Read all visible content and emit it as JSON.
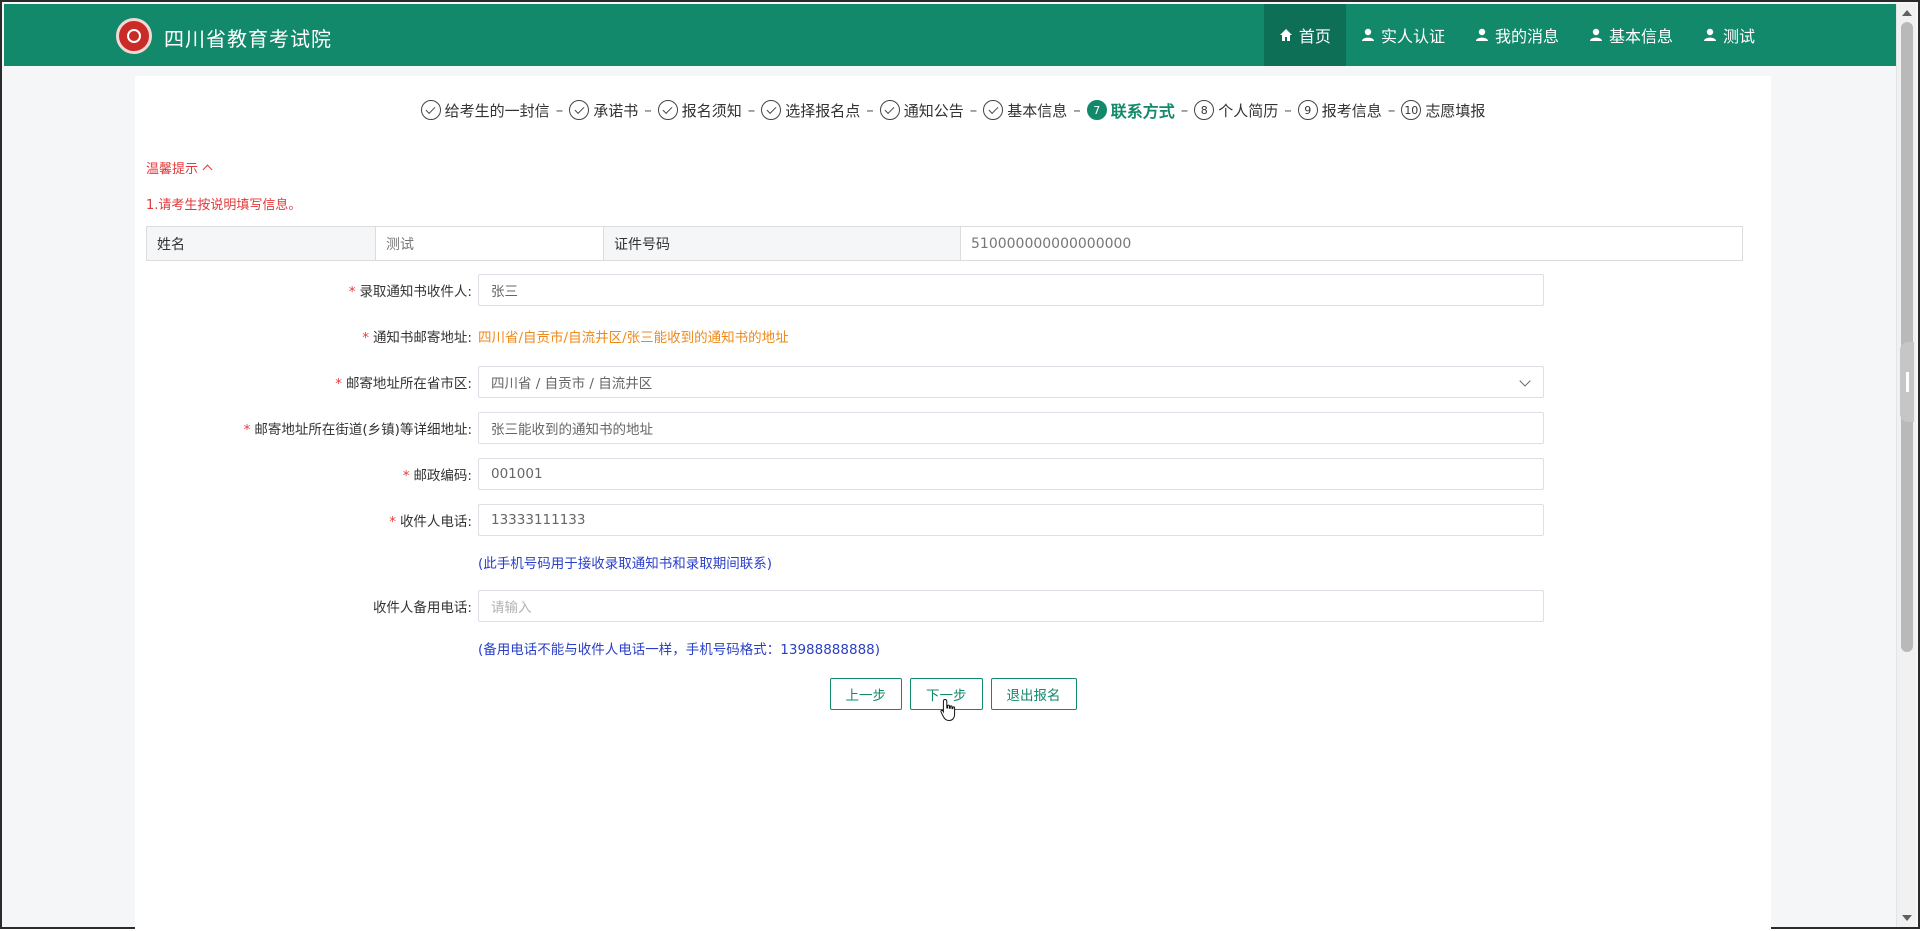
{
  "header": {
    "site_title": "四川省教育考试院",
    "nav": [
      {
        "label": "首页",
        "icon": "home-icon",
        "active": true
      },
      {
        "label": "实人认证",
        "icon": "user-icon"
      },
      {
        "label": "我的消息",
        "icon": "user-icon"
      },
      {
        "label": "基本信息",
        "icon": "user-icon"
      },
      {
        "label": "测试",
        "icon": "user-icon"
      }
    ]
  },
  "steps": [
    {
      "label": "给考生的一封信",
      "state": "done"
    },
    {
      "label": "承诺书",
      "state": "done"
    },
    {
      "label": "报名须知",
      "state": "done"
    },
    {
      "label": "选择报名点",
      "state": "done"
    },
    {
      "label": "通知公告",
      "state": "done"
    },
    {
      "label": "基本信息",
      "state": "done"
    },
    {
      "label": "联系方式",
      "state": "current",
      "number": "7"
    },
    {
      "label": "个人简历",
      "state": "todo",
      "number": "8"
    },
    {
      "label": "报考信息",
      "state": "todo",
      "number": "9"
    },
    {
      "label": "志愿填报",
      "state": "todo",
      "number": "10"
    }
  ],
  "tips": {
    "title": "温馨提示",
    "line1": "1.请考生按说明填写信息。"
  },
  "info": {
    "name_label": "姓名",
    "name_value": "测试",
    "id_label": "证件号码",
    "id_value": "510000000000000000"
  },
  "form": {
    "recipient_label": "录取通知书收件人:",
    "recipient_value": "张三",
    "address_label": "通知书邮寄地址:",
    "address_value": "四川省/自贡市/自流井区/张三能收到的通知书的地址",
    "region_label": "邮寄地址所在省市区:",
    "region_value": "四川省 / 自贡市 / 自流井区",
    "detail_label": "邮寄地址所在街道(乡镇)等详细地址:",
    "detail_value": "张三能收到的通知书的地址",
    "postcode_label": "邮政编码:",
    "postcode_value": "001001",
    "phone_label": "收件人电话:",
    "phone_value": "13333111133",
    "phone_hint": "(此手机号码用于接收录取通知书和录取期间联系)",
    "backup_label": "收件人备用电话:",
    "backup_placeholder": "请输入",
    "backup_hint": "(备用电话不能与收件人电话一样，手机号码格式：13988888888)"
  },
  "buttons": {
    "prev": "上一步",
    "next": "下一步",
    "quit": "退出报名"
  },
  "colors": {
    "brand": "#13896b",
    "warning": "#e4393c",
    "address": "#ee8a1a",
    "hint": "#2a3fc8"
  }
}
